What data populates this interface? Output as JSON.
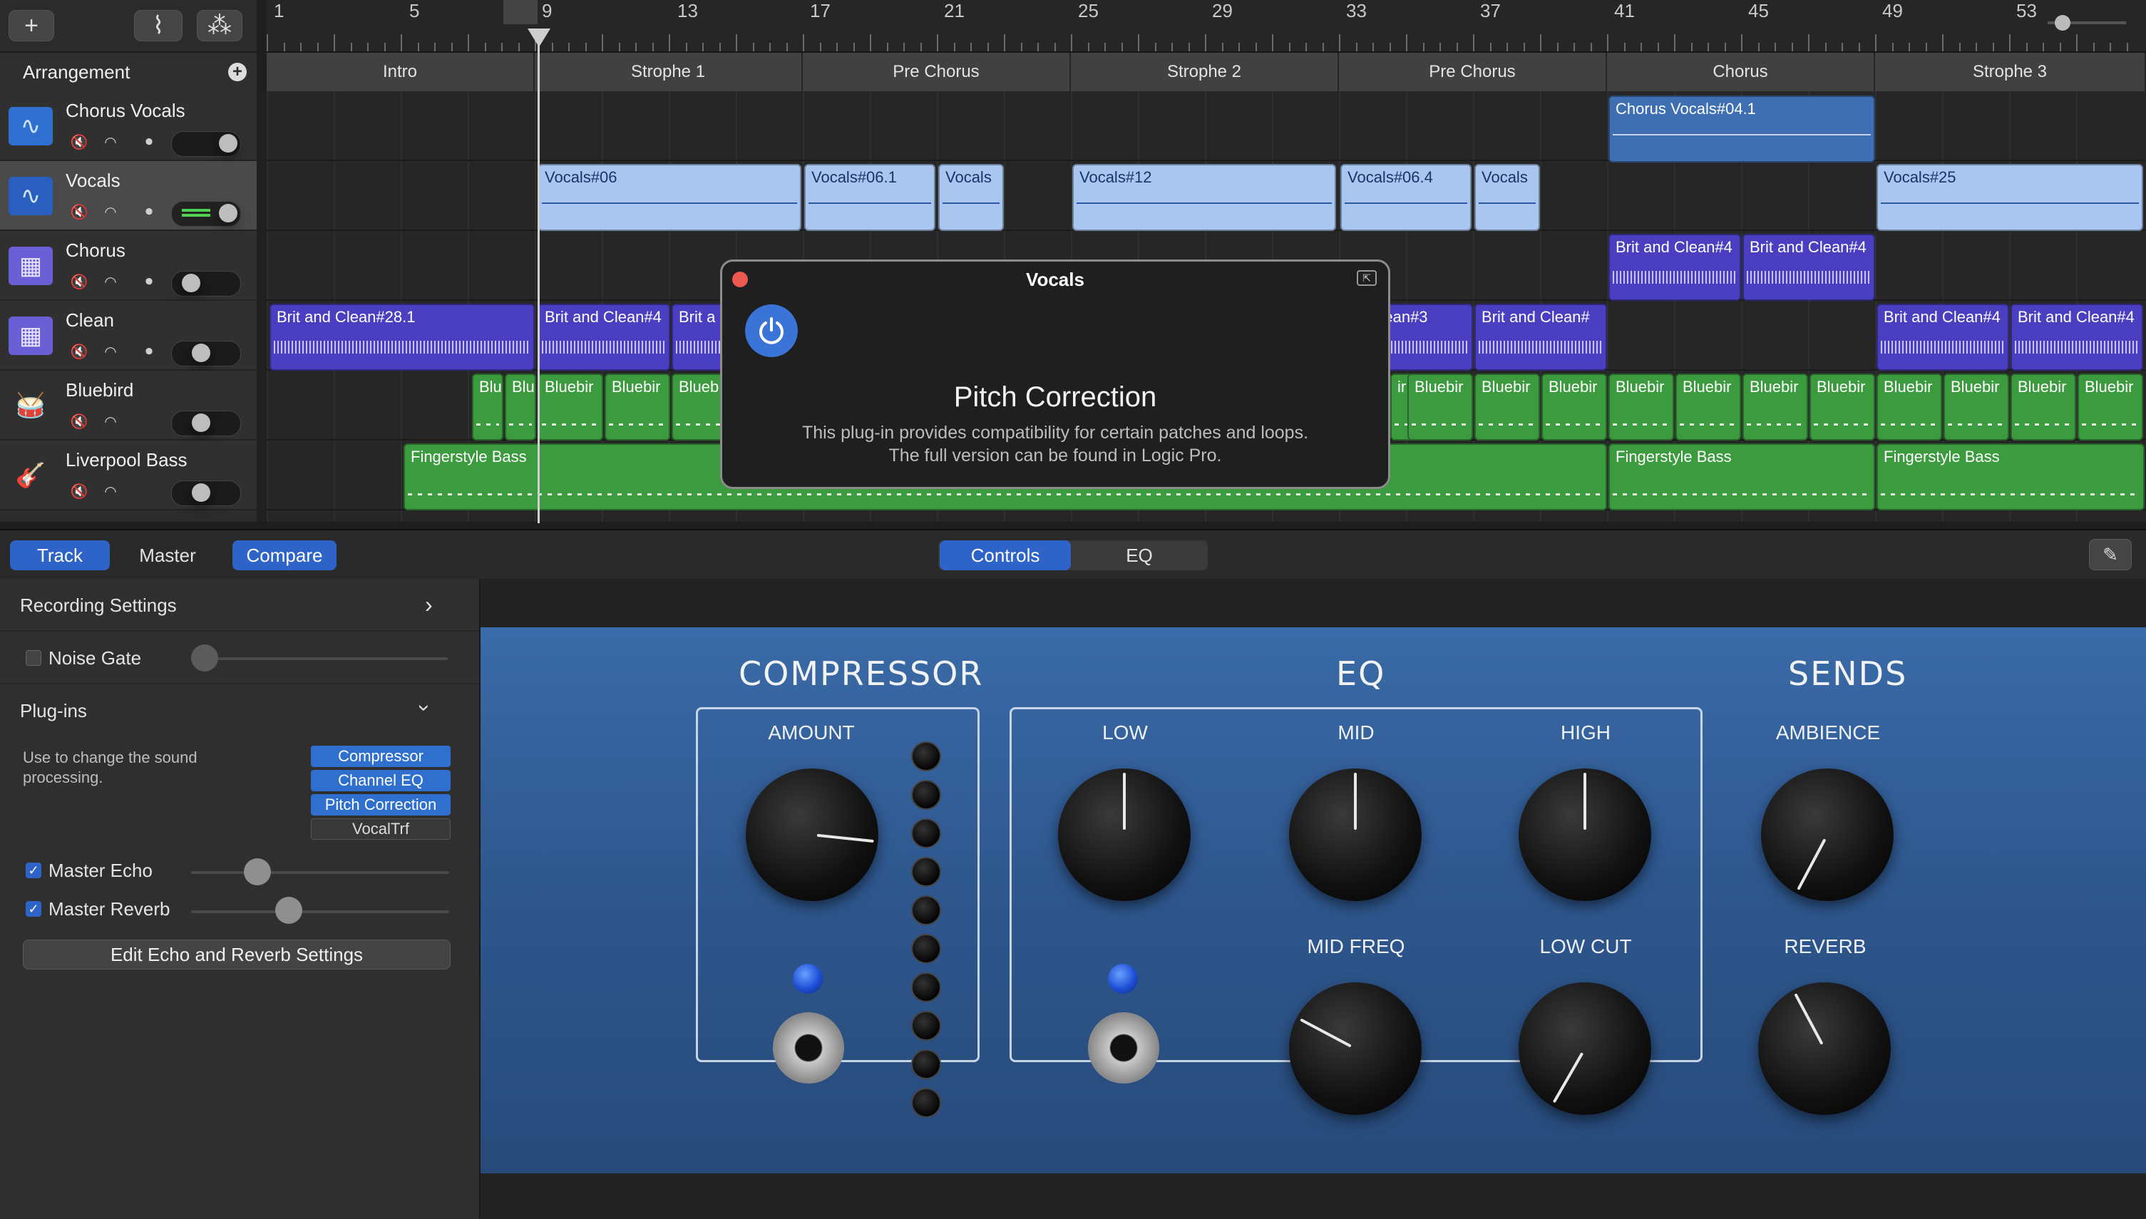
{
  "toolbar": {
    "add": "+",
    "automation": "⌇",
    "smart": "⁂"
  },
  "ruler": {
    "bars": [
      "1",
      "5",
      "9",
      "13",
      "17",
      "21",
      "25",
      "29",
      "33",
      "37",
      "41",
      "45",
      "49",
      "53"
    ]
  },
  "arrangement": {
    "title": "Arrangement",
    "add": "+",
    "markers": [
      "Intro",
      "Strophe 1",
      "Pre Chorus",
      "Strophe 2",
      "Pre Chorus",
      "Chorus",
      "Strophe 3"
    ]
  },
  "tracks": [
    {
      "name": "Chorus Vocals"
    },
    {
      "name": "Vocals"
    },
    {
      "name": "Chorus"
    },
    {
      "name": "Clean"
    },
    {
      "name": "Bluebird"
    },
    {
      "name": "Liverpool Bass"
    }
  ],
  "regions": {
    "chorus_vocals": [
      "Chorus Vocals#04.1"
    ],
    "vocals": [
      "Vocals#06",
      "Vocals#06.1",
      "Vocals",
      "Vocals#12",
      "Vocals#06.4",
      "Vocals",
      "Vocals#25"
    ],
    "chorus": [
      "Brit and Clean#4",
      "Brit and Clean#4"
    ],
    "clean": [
      "Brit and Clean#28.1",
      "Brit and Clean#4",
      "Brit a",
      "nd Clean#3",
      "Brit and Clean#",
      "Brit and Clean#4",
      "Brit and Clean#4"
    ],
    "bluebird": [
      "Blu",
      "Blu",
      "Bluebir",
      "Bluebir",
      "Blueb",
      "ir",
      "Bluebir",
      "Bluebir",
      "Bluebir",
      "Bluebir",
      "Bluebir",
      "Bluebir",
      "Bluebir",
      "Bluebir",
      "Bluebir",
      "Bluebir",
      "Bluebir"
    ],
    "bass": [
      "Fingerstyle Bass",
      "Fingerstyle Bass",
      "Fingerstyle Bass"
    ]
  },
  "popup": {
    "title": "Vocals",
    "heading": "Pitch Correction",
    "line1": "This plug-in provides compatibility for certain patches and loops.",
    "line2": "The full version can be found in Logic Pro."
  },
  "bottom_toolbar": {
    "tabs": [
      "Track",
      "Master",
      "Compare"
    ],
    "view_tabs": [
      "Controls",
      "EQ"
    ]
  },
  "left_panel": {
    "recording_settings": "Recording Settings",
    "noise_gate": "Noise Gate",
    "plugins": "Plug-ins",
    "plugins_desc_1": "Use to change the sound",
    "plugins_desc_2": "processing.",
    "plugin_list": [
      "Compressor",
      "Channel EQ",
      "Pitch Correction",
      "VocalTrf"
    ],
    "master_echo": "Master Echo",
    "master_reverb": "Master Reverb",
    "edit_button": "Edit Echo and Reverb Settings"
  },
  "plugin": {
    "sections": [
      "COMPRESSOR",
      "EQ",
      "SENDS"
    ],
    "knobs": {
      "amount": "AMOUNT",
      "low": "LOW",
      "mid": "MID",
      "high": "HIGH",
      "mid_freq": "MID FREQ",
      "low_cut": "LOW CUT",
      "ambience": "AMBIENCE",
      "reverb": "REVERB"
    }
  },
  "colors": {
    "accent": "#2e63c8",
    "audio_region": "#3f6fb3",
    "audio_region_light": "#a8c6f0",
    "purple_region": "#4b3fc1",
    "green_region": "#3d9b3f",
    "plugin_face": "#2f588f"
  }
}
